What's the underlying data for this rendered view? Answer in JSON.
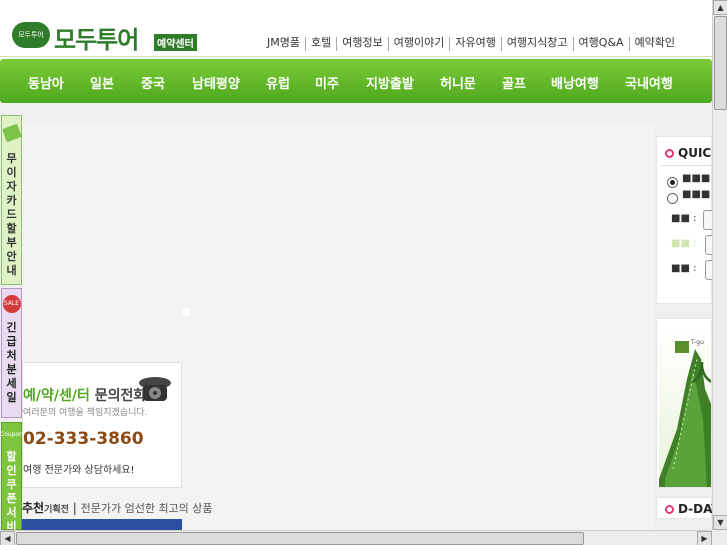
{
  "header": {
    "logo_small": "모두투어",
    "logo_name": "모두투어",
    "logo_tag": "예약센터",
    "top_menu": [
      "JM명품",
      "호텔",
      "여행정보",
      "여행이야기",
      "자유여행",
      "여행지식창고",
      "여행Q&A",
      "예약확인"
    ]
  },
  "nav": {
    "items": [
      "동남아",
      "일본",
      "중국",
      "남태평양",
      "유럽",
      "미주",
      "지방출발",
      "허니문",
      "골프",
      "배낭여행",
      "국내여행"
    ],
    "color": "#5db32a"
  },
  "left_banners": {
    "card": "무이자카드 할부안내",
    "sale_badge": "SALE",
    "sale": "긴급 처분세일",
    "coupon_badge": "Coupon",
    "coupon": "할인쿠폰서비"
  },
  "reservation_box": {
    "title_marked": "예/약/센/터",
    "title_rest": " 문의전화",
    "subtitle": "여러분의 여행을 책임지겠습니다.",
    "phone": "02-333-3860",
    "note": "여행 전문가와 상담하세요!"
  },
  "recommend": {
    "title": "추천",
    "sub": "기획전",
    "divider": " | ",
    "desc": "전문가가 엄선한 최고의 상품"
  },
  "quick": {
    "title": "QUICK",
    "option1": "■■■",
    "option2": "■■■",
    "label1": "■■ :",
    "label2": "■■ :",
    "label3": "■■ :"
  },
  "right_banner": {
    "text": "T-gu"
  },
  "dday": {
    "title": "D-DAY S"
  },
  "colors": {
    "brand_green": "#2f7d2b",
    "nav_green": "#5db32a",
    "phone_brown": "#8b4a14",
    "accent_pink": "#e8337a"
  }
}
